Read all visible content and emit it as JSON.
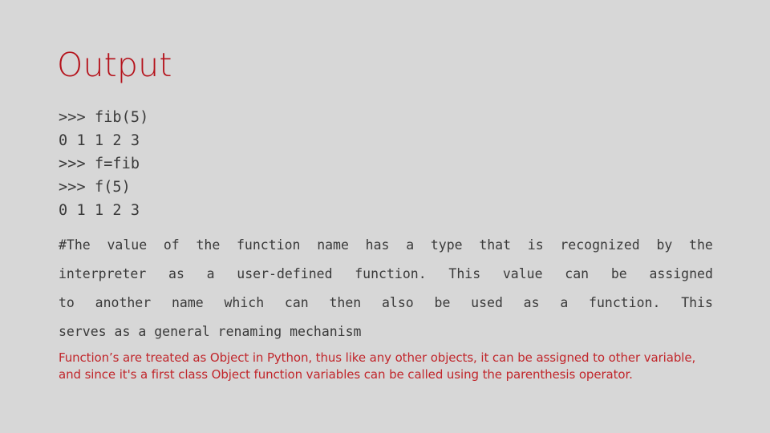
{
  "slide": {
    "title": "Output",
    "background_color": "#d7d7d7",
    "title_color": "#b5121b",
    "note_color": "#c1262b",
    "code_color": "#3a3a3a"
  },
  "code_block": {
    "lines": [
      ">>> fib(5)",
      "0 1 1 2 3",
      ">>> f=fib",
      ">>> f(5)",
      "0 1 1 2 3"
    ]
  },
  "body_paragraph": {
    "full_text": "#The value of the function name has a type that is recognized by the interpreter as a user-defined function. This value can be assigned to another name which can then also be used as a function. This serves as a general renaming mechanism",
    "lines": [
      {
        "words": [
          "#The",
          "value",
          "of",
          "the",
          "function",
          "name",
          "has",
          "a",
          "type",
          "that",
          "is",
          "recognized",
          "by",
          "the"
        ]
      },
      {
        "words": [
          "interpreter",
          "as",
          "a",
          "user-defined",
          "function.",
          "This",
          "value",
          "can",
          "be",
          "assigned"
        ]
      },
      {
        "words": [
          "to",
          "another",
          "name",
          "which",
          "can",
          "then",
          "also",
          "be",
          "used",
          "as",
          "a",
          "function.",
          "This"
        ]
      },
      {
        "text": "serves as a general renaming mechanism"
      }
    ]
  },
  "note_block": {
    "lines": [
      "Function’s are treated as Object in Python, thus like any other objects, it can be assigned to other variable,",
      "and since it's a first class Object function variables can be called using the parenthesis operator."
    ]
  }
}
